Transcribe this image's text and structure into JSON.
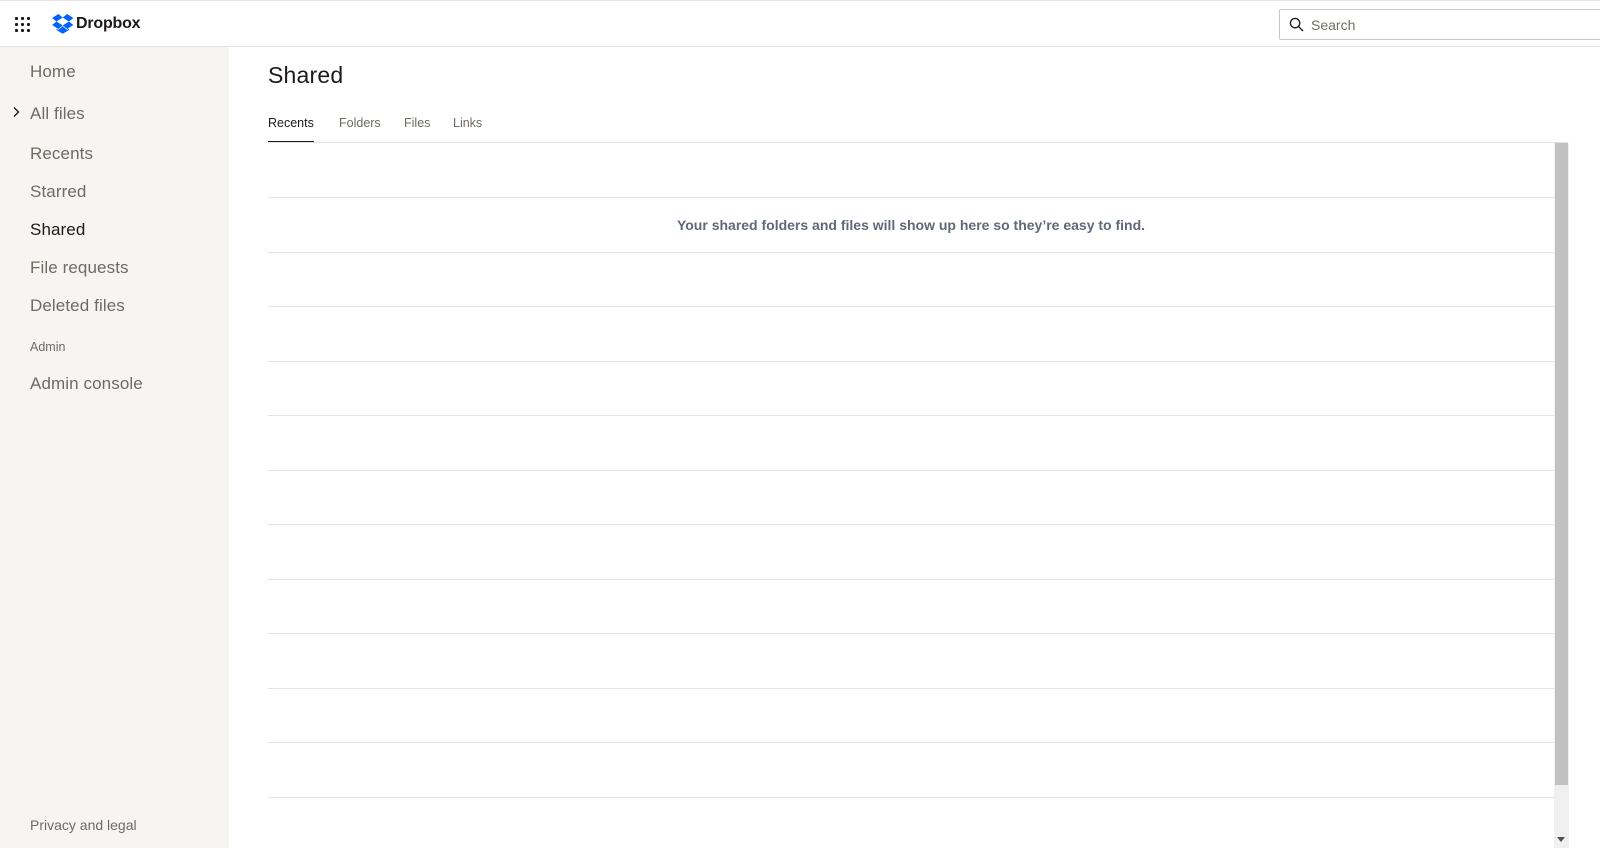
{
  "header": {
    "brand": "Dropbox",
    "search_placeholder": "Search"
  },
  "sidebar": {
    "items": [
      {
        "label": "Home"
      },
      {
        "label": "All files"
      },
      {
        "label": "Recents"
      },
      {
        "label": "Starred"
      },
      {
        "label": "Shared"
      },
      {
        "label": "File requests"
      },
      {
        "label": "Deleted files"
      }
    ],
    "section_admin": "Admin",
    "admin_console": "Admin console",
    "footer_link": "Privacy and legal",
    "active_item": "Shared"
  },
  "main": {
    "title": "Shared",
    "tabs": [
      {
        "label": "Recents"
      },
      {
        "label": "Folders"
      },
      {
        "label": "Files"
      },
      {
        "label": "Links"
      }
    ],
    "active_tab": "Recents",
    "empty_message": "Your shared folders and files will show up here so they’re easy to find."
  },
  "colors": {
    "brand_blue": "#0061fe",
    "sidebar_bg": "#f7f5f2",
    "text_primary": "#1e1919",
    "text_secondary": "#6f6a63"
  },
  "icons": {
    "app_grid": "app-grid-icon",
    "logo": "dropbox-logo-icon",
    "search": "search-icon",
    "chevron": "chevron-right-icon"
  }
}
